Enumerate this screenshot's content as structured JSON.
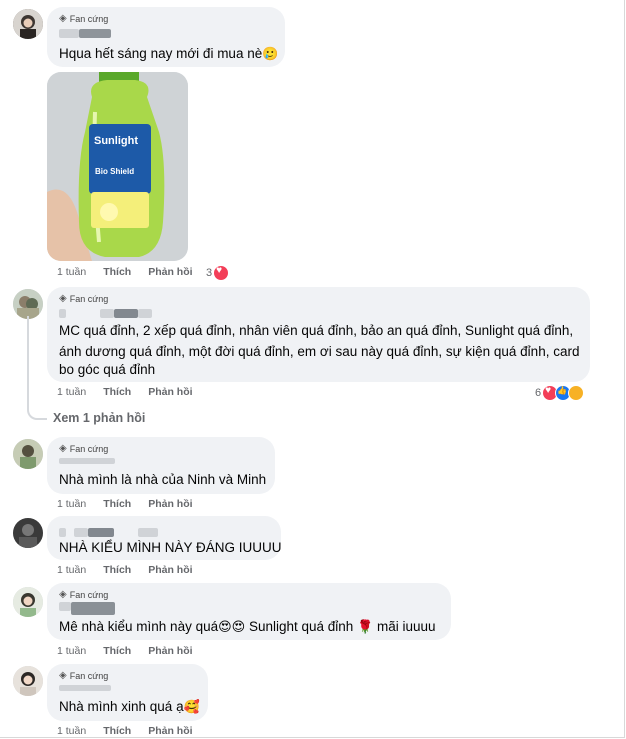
{
  "badge_label": "Fan cứng",
  "comments": [
    {
      "text": "Hqua hết sáng nay mới đi mua nè",
      "emoji": "🥲",
      "time": "1 tuần",
      "like": "Thích",
      "reply": "Phản hồi",
      "reactions": "3"
    },
    {
      "lines": [
        "MC quá đỉnh, 2 xếp quá đỉnh, nhân viên quá đỉnh, bảo an quá đỉnh, Sunlight quá đỉnh,",
        "ánh dương quá đỉnh, một đời quá đỉnh, em ơi sau này quá đỉnh, sự kiện quá đỉnh, card",
        "bo góc quá đỉnh"
      ],
      "time": "1 tuần",
      "like": "Thích",
      "reply": "Phản hồi",
      "reactions": "6",
      "view_replies": "Xem 1 phản hồi"
    },
    {
      "text": "Nhà mình là nhà của Ninh và Minh",
      "time": "1 tuần",
      "like": "Thích",
      "reply": "Phản hồi"
    },
    {
      "text": "NHÀ KIỂU MÌNH NÀY ĐÁNG IUUUU",
      "time": "1 tuần",
      "like": "Thích",
      "reply": "Phản hồi"
    },
    {
      "text_a": "Mê nhà kiểu mình này quá",
      "emoji_a": "😍😍",
      "text_b": " Sunlight quá đỉnh ",
      "emoji_b": "🌹",
      "text_c": " mãi iuuuu",
      "time": "1 tuần",
      "like": "Thích",
      "reply": "Phản hồi"
    },
    {
      "text": "Nhà mình xinh quá ạ",
      "emoji": "🥰",
      "time": "1 tuần",
      "like": "Thích",
      "reply": "Phản hồi"
    }
  ],
  "photo": {
    "brand": "Sunlight",
    "sub": "Bio Shield"
  },
  "icons": {
    "badge": "diamond-icon",
    "love": "love-reaction-icon",
    "like": "like-reaction-icon",
    "haha": "haha-reaction-icon"
  },
  "colors": {
    "bubble": "#f0f2f5",
    "meta": "#65676b",
    "love": "#f33e58",
    "like": "#1877f2"
  }
}
